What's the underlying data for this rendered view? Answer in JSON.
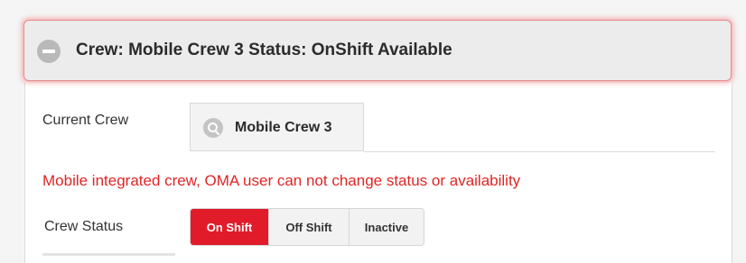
{
  "header": {
    "title": "Crew: Mobile Crew 3 Status: OnShift Available",
    "icon": "collapse-icon"
  },
  "current_crew": {
    "label": "Current Crew",
    "value": "Mobile Crew 3",
    "icon": "search-icon"
  },
  "warning": {
    "text": "Mobile integrated crew, OMA user can not change status or availability",
    "color": "#e02424"
  },
  "crew_status": {
    "label": "Crew Status",
    "options": [
      {
        "label": "On Shift",
        "selected": true
      },
      {
        "label": "Off Shift",
        "selected": false
      },
      {
        "label": "Inactive",
        "selected": false
      }
    ],
    "active_color": "#e21b2a"
  }
}
